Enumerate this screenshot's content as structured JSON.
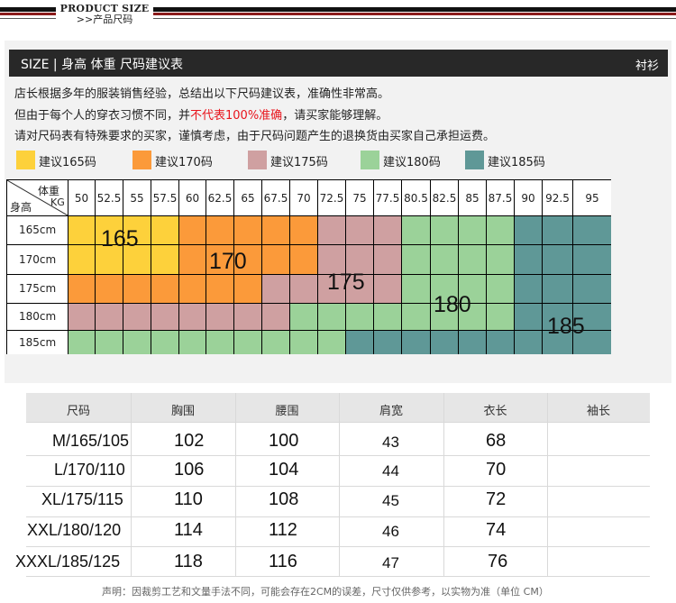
{
  "header": {
    "title_en": "PRODUCT SIZE",
    "title_cn": ">>产品尺码"
  },
  "bar": {
    "title": "SIZE | 身高 体重 尺码建议表",
    "category": "衬衫"
  },
  "intro": {
    "line1": "店长根据多年的服装销售经验，总结出以下尺码建议表，准确性非常高。",
    "line2_a": "但由于每个人的穿衣习惯不同，并",
    "line2_red": "不代表100%准确",
    "line2_b": "，请买家能够理解。",
    "line3": "请对尺码表有特殊要求的买家，谨慎考虑，由于尺码问题产生的退换货由买家自己承担运费。"
  },
  "legend": [
    {
      "label": "建议165码",
      "color": "#fdd13b"
    },
    {
      "label": "建议170码",
      "color": "#fb9a3a"
    },
    {
      "label": "建议175码",
      "color": "#cfa0a1"
    },
    {
      "label": "建议180码",
      "color": "#9bd299"
    },
    {
      "label": "建议185码",
      "color": "#5f9897"
    }
  ],
  "grid": {
    "corner_weight": "体重",
    "corner_unit": "KG",
    "corner_height": "身高",
    "weights": [
      "50",
      "52.5",
      "55",
      "57.5",
      "60",
      "62.5",
      "65",
      "67.5",
      "70",
      "72.5",
      "75",
      "77.5",
      "80.5",
      "82.5",
      "85",
      "87.5",
      "90",
      "92.5",
      "95"
    ],
    "heights": [
      "165cm",
      "170cm",
      "175cm",
      "180cm",
      "185cm"
    ],
    "rows": [
      [
        0,
        0,
        0,
        0,
        1,
        1,
        1,
        1,
        1,
        2,
        2,
        2,
        3,
        3,
        3,
        3,
        4,
        4,
        4
      ],
      [
        0,
        0,
        0,
        0,
        1,
        1,
        1,
        1,
        1,
        2,
        2,
        2,
        3,
        3,
        3,
        3,
        4,
        4,
        4
      ],
      [
        1,
        1,
        1,
        1,
        1,
        1,
        1,
        2,
        2,
        2,
        2,
        2,
        3,
        3,
        3,
        3,
        4,
        4,
        4
      ],
      [
        2,
        2,
        2,
        2,
        2,
        2,
        2,
        2,
        3,
        3,
        3,
        3,
        3,
        3,
        3,
        3,
        4,
        4,
        4
      ],
      [
        3,
        3,
        3,
        3,
        3,
        3,
        3,
        3,
        3,
        3,
        4,
        4,
        4,
        4,
        4,
        4,
        4,
        4,
        4
      ]
    ],
    "big_labels": [
      "165",
      "170",
      "175",
      "180",
      "185"
    ]
  },
  "size_table": {
    "headers": [
      "尺码",
      "胸围",
      "腰围",
      "肩宽",
      "衣长",
      "袖长"
    ],
    "rows": [
      {
        "size": "M/165/105",
        "chest": "102",
        "waist": "100",
        "shoulder": "43",
        "length": "68",
        "sleeve": ""
      },
      {
        "size": "L/170/110",
        "chest": "106",
        "waist": "104",
        "shoulder": "44",
        "length": "70",
        "sleeve": ""
      },
      {
        "size": "XL/175/115",
        "chest": "110",
        "waist": "108",
        "shoulder": "45",
        "length": "72",
        "sleeve": ""
      },
      {
        "size": "XXL/180/120",
        "chest": "114",
        "waist": "112",
        "shoulder": "46",
        "length": "74",
        "sleeve": ""
      },
      {
        "size": "XXXL/185/125",
        "chest": "118",
        "waist": "116",
        "shoulder": "47",
        "length": "76",
        "sleeve": ""
      }
    ]
  },
  "note": "声明：因裁剪工艺和文量手法不同，可能会存在2CM的误差，尺寸仅供参考，以实物为准（单位 CM）"
}
